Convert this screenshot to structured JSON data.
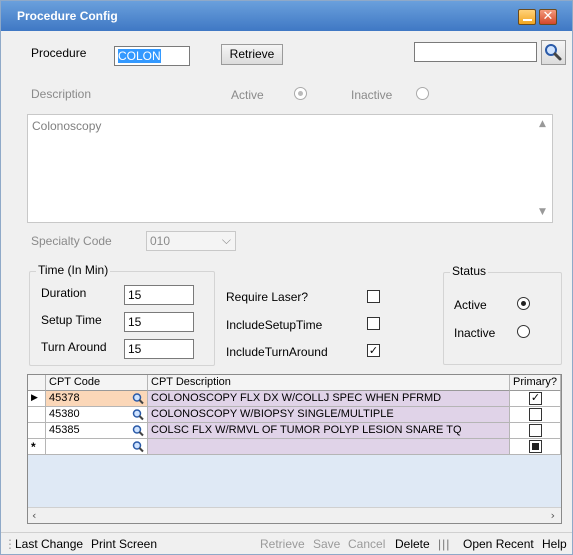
{
  "window": {
    "title": "Procedure Config"
  },
  "procedure": {
    "label": "Procedure",
    "value": "COLON",
    "retrieve_label": "Retrieve",
    "search_value": ""
  },
  "description": {
    "label": "Description",
    "active_label": "Active",
    "inactive_label": "Inactive",
    "text": "Colonoscopy"
  },
  "specialty": {
    "label": "Specialty Code",
    "value": "010"
  },
  "time": {
    "caption": "Time (In Min)",
    "duration_label": "Duration",
    "duration": "15",
    "setup_label": "Setup Time",
    "setup": "15",
    "turnaround_label": "Turn Around",
    "turnaround": "15"
  },
  "options": {
    "require_laser_label": "Require Laser?",
    "require_laser": false,
    "include_setup_label": "IncludeSetupTime",
    "include_setup": false,
    "include_turnaround_label": "IncludeTurnAround",
    "include_turnaround": true
  },
  "status": {
    "caption": "Status",
    "active_label": "Active",
    "inactive_label": "Inactive",
    "selected": "Active"
  },
  "grid": {
    "columns": [
      "CPT Code",
      "CPT Description",
      "Primary?"
    ],
    "rows": [
      {
        "code": "45378",
        "description": "COLONOSCOPY FLX DX W/COLLJ SPEC WHEN PFRMD",
        "primary": true
      },
      {
        "code": "45380",
        "description": "COLONOSCOPY W/BIOPSY SINGLE/MULTIPLE",
        "primary": false
      },
      {
        "code": "45385",
        "description": "COLSC FLX W/RMVL OF TUMOR POLYP LESION SNARE TQ",
        "primary": false
      }
    ]
  },
  "statusbar": {
    "last_change": "Last Change",
    "print_screen": "Print Screen",
    "retrieve": "Retrieve",
    "save": "Save",
    "cancel": "Cancel",
    "delete": "Delete",
    "open_recent": "Open Recent",
    "help": "Help"
  }
}
